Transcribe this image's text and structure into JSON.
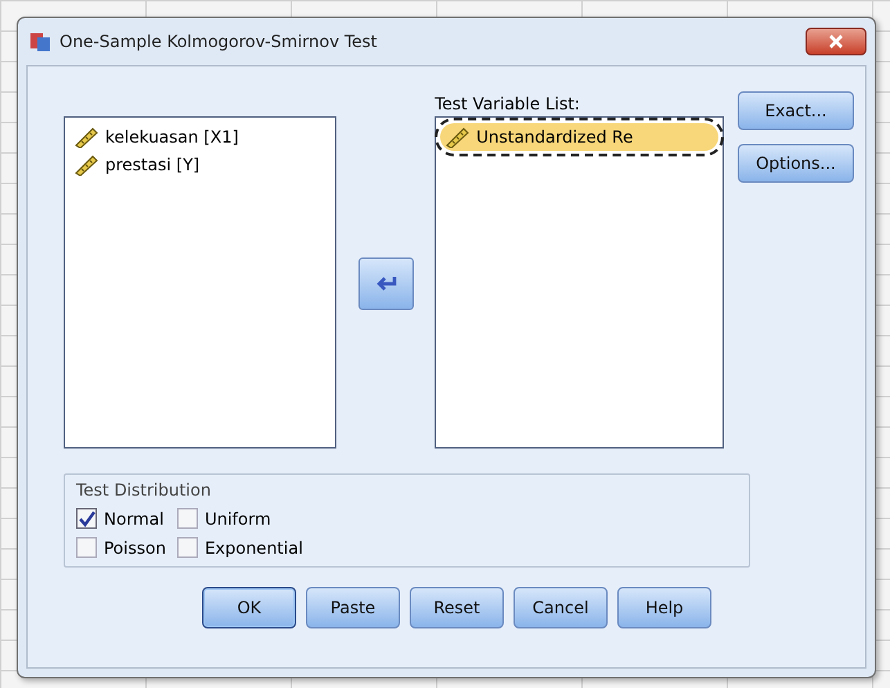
{
  "window": {
    "title": "One-Sample Kolmogorov-Smirnov Test"
  },
  "source_list": {
    "items": [
      {
        "label": "kelekuasan [X1]",
        "selected": false
      },
      {
        "label": "prestasi [Y]",
        "selected": false
      }
    ]
  },
  "test_variable_list": {
    "label": "Test Variable List:",
    "items": [
      {
        "label": "Unstandardized Re",
        "selected": true,
        "circled": true
      }
    ]
  },
  "side_buttons": [
    "Exact...",
    "Options..."
  ],
  "distribution": {
    "title": "Test Distribution",
    "options": [
      {
        "label": "Normal",
        "checked": true
      },
      {
        "label": "Uniform",
        "checked": false
      },
      {
        "label": "Poisson",
        "checked": false
      },
      {
        "label": "Exponential",
        "checked": false
      }
    ]
  },
  "buttons": [
    {
      "label": "OK",
      "default": true
    },
    {
      "label": "Paste",
      "default": false
    },
    {
      "label": "Reset",
      "default": false
    },
    {
      "label": "Cancel",
      "default": false
    },
    {
      "label": "Help",
      "default": false
    }
  ]
}
